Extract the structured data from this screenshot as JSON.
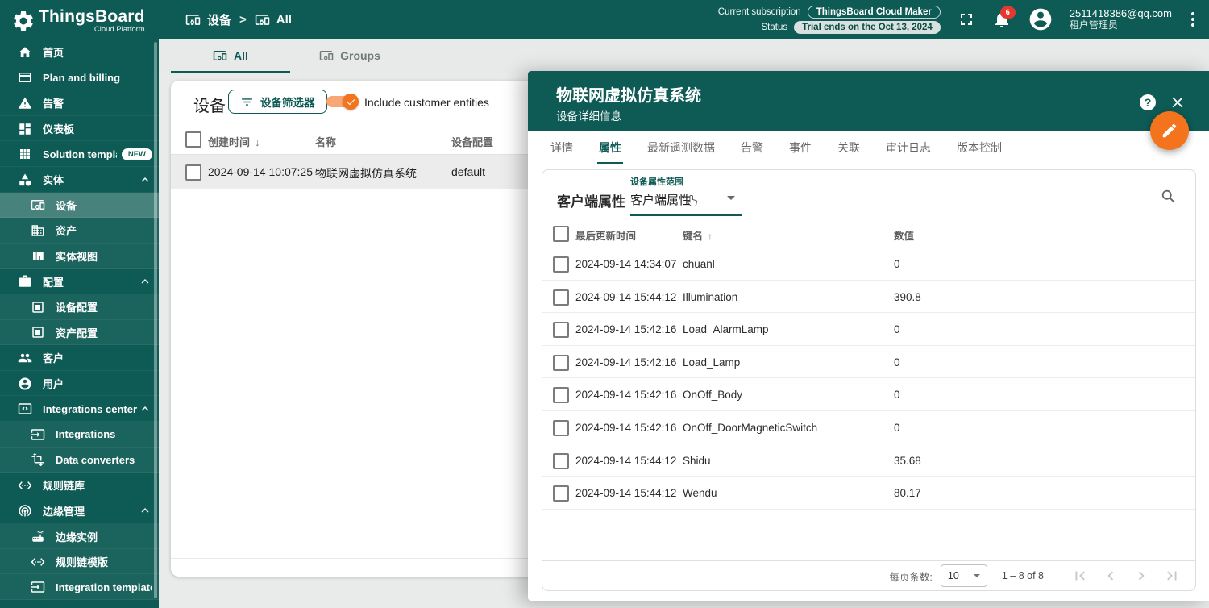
{
  "colors": {
    "primary": "#0e5a54",
    "accent": "#f4741e",
    "alert_badge": "#e5392e",
    "selected_row": "#ececec"
  },
  "brand": {
    "name": "ThingsBoard",
    "subtitle": "Cloud Platform"
  },
  "topbar": {
    "breadcrumb": {
      "root": "设备",
      "current": "All"
    },
    "subscription_label": "Current subscription",
    "subscription_value": "ThingsBoard Cloud Maker",
    "status_label": "Status",
    "status_value": "Trial ends on the Oct 13, 2024",
    "notification_count": "6",
    "user_email": "2511418386@qq.com",
    "user_role": "租户管理员"
  },
  "sidebar": {
    "items": [
      {
        "label": "首页"
      },
      {
        "label": "Plan and billing"
      },
      {
        "label": "告警"
      },
      {
        "label": "仪表板"
      },
      {
        "label": "Solution templates",
        "badge": "NEW"
      },
      {
        "label": "实体"
      },
      {
        "label": "设备"
      },
      {
        "label": "资产"
      },
      {
        "label": "实体视图"
      },
      {
        "label": "配置"
      },
      {
        "label": "设备配置"
      },
      {
        "label": "资产配置"
      },
      {
        "label": "客户"
      },
      {
        "label": "用户"
      },
      {
        "label": "Integrations center"
      },
      {
        "label": "Integrations"
      },
      {
        "label": "Data converters"
      },
      {
        "label": "规则链库"
      },
      {
        "label": "边缘管理"
      },
      {
        "label": "边缘实例"
      },
      {
        "label": "规则链模版"
      },
      {
        "label": "Integration templates"
      }
    ]
  },
  "content_tabs": {
    "all": "All",
    "groups": "Groups"
  },
  "device_page": {
    "title": "设备",
    "filter_button": "设备筛选器",
    "toggle_label": "Include customer entities",
    "headers": {
      "created": "创建时间",
      "name": "名称",
      "profile": "设备配置"
    },
    "row": {
      "created": "2024-09-14 10:07:25",
      "name": "物联网虚拟仿真系统",
      "profile": "default"
    }
  },
  "panel": {
    "title": "物联网虚拟仿真系统",
    "subtitle": "设备详细信息",
    "tabs": [
      "详情",
      "属性",
      "最新遥测数据",
      "告警",
      "事件",
      "关联",
      "审计日志",
      "版本控制"
    ],
    "attributes": {
      "section_title": "客户端属性",
      "scope_label": "设备属性范围",
      "scope_value": "客户端属性",
      "headers": {
        "time": "最后更新时间",
        "key": "键名",
        "value": "数值"
      },
      "rows": [
        {
          "time": "2024-09-14 14:34:07",
          "key": "chuanl",
          "value": "0"
        },
        {
          "time": "2024-09-14 15:44:12",
          "key": "Illumination",
          "value": "390.8"
        },
        {
          "time": "2024-09-14 15:42:16",
          "key": "Load_AlarmLamp",
          "value": "0"
        },
        {
          "time": "2024-09-14 15:42:16",
          "key": "Load_Lamp",
          "value": "0"
        },
        {
          "time": "2024-09-14 15:42:16",
          "key": "OnOff_Body",
          "value": "0"
        },
        {
          "time": "2024-09-14 15:42:16",
          "key": "OnOff_DoorMagneticSwitch",
          "value": "0"
        },
        {
          "time": "2024-09-14 15:44:12",
          "key": "Shidu",
          "value": "35.68"
        },
        {
          "time": "2024-09-14 15:44:12",
          "key": "Wendu",
          "value": "80.17"
        }
      ],
      "pagination": {
        "label": "每页条数:",
        "page_size": "10",
        "range": "1 – 8 of 8"
      }
    }
  }
}
